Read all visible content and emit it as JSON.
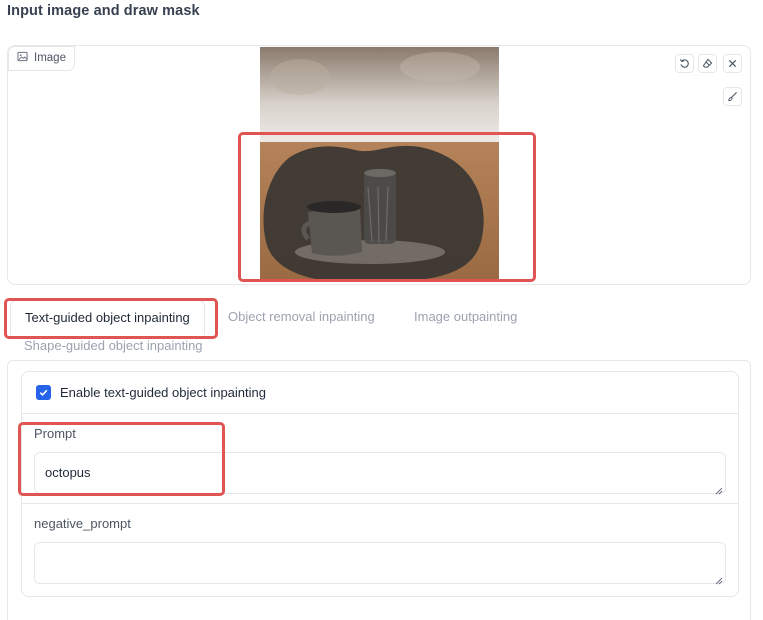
{
  "section": {
    "title": "Input image and draw mask"
  },
  "image_panel": {
    "label": "Image",
    "label_icon": "image-icon",
    "tools": [
      "undo-icon",
      "eraser-icon",
      "close-icon",
      "brush-icon"
    ]
  },
  "tabs": [
    {
      "label": "Text-guided object inpainting",
      "selected": true
    },
    {
      "label": "Object removal inpainting",
      "selected": false
    },
    {
      "label": "Image outpainting",
      "selected": false
    },
    {
      "label": "Shape-guided object inpainting",
      "selected": false
    }
  ],
  "form": {
    "checkbox_label": "Enable text-guided object inpainting",
    "checkbox_checked": true,
    "prompt_label": "Prompt",
    "prompt_value": "octopus",
    "negative_prompt_label": "negative_prompt",
    "negative_prompt_value": ""
  },
  "colors": {
    "highlight": "#e05454",
    "accent": "#2563eb",
    "border": "#e5e7eb"
  }
}
